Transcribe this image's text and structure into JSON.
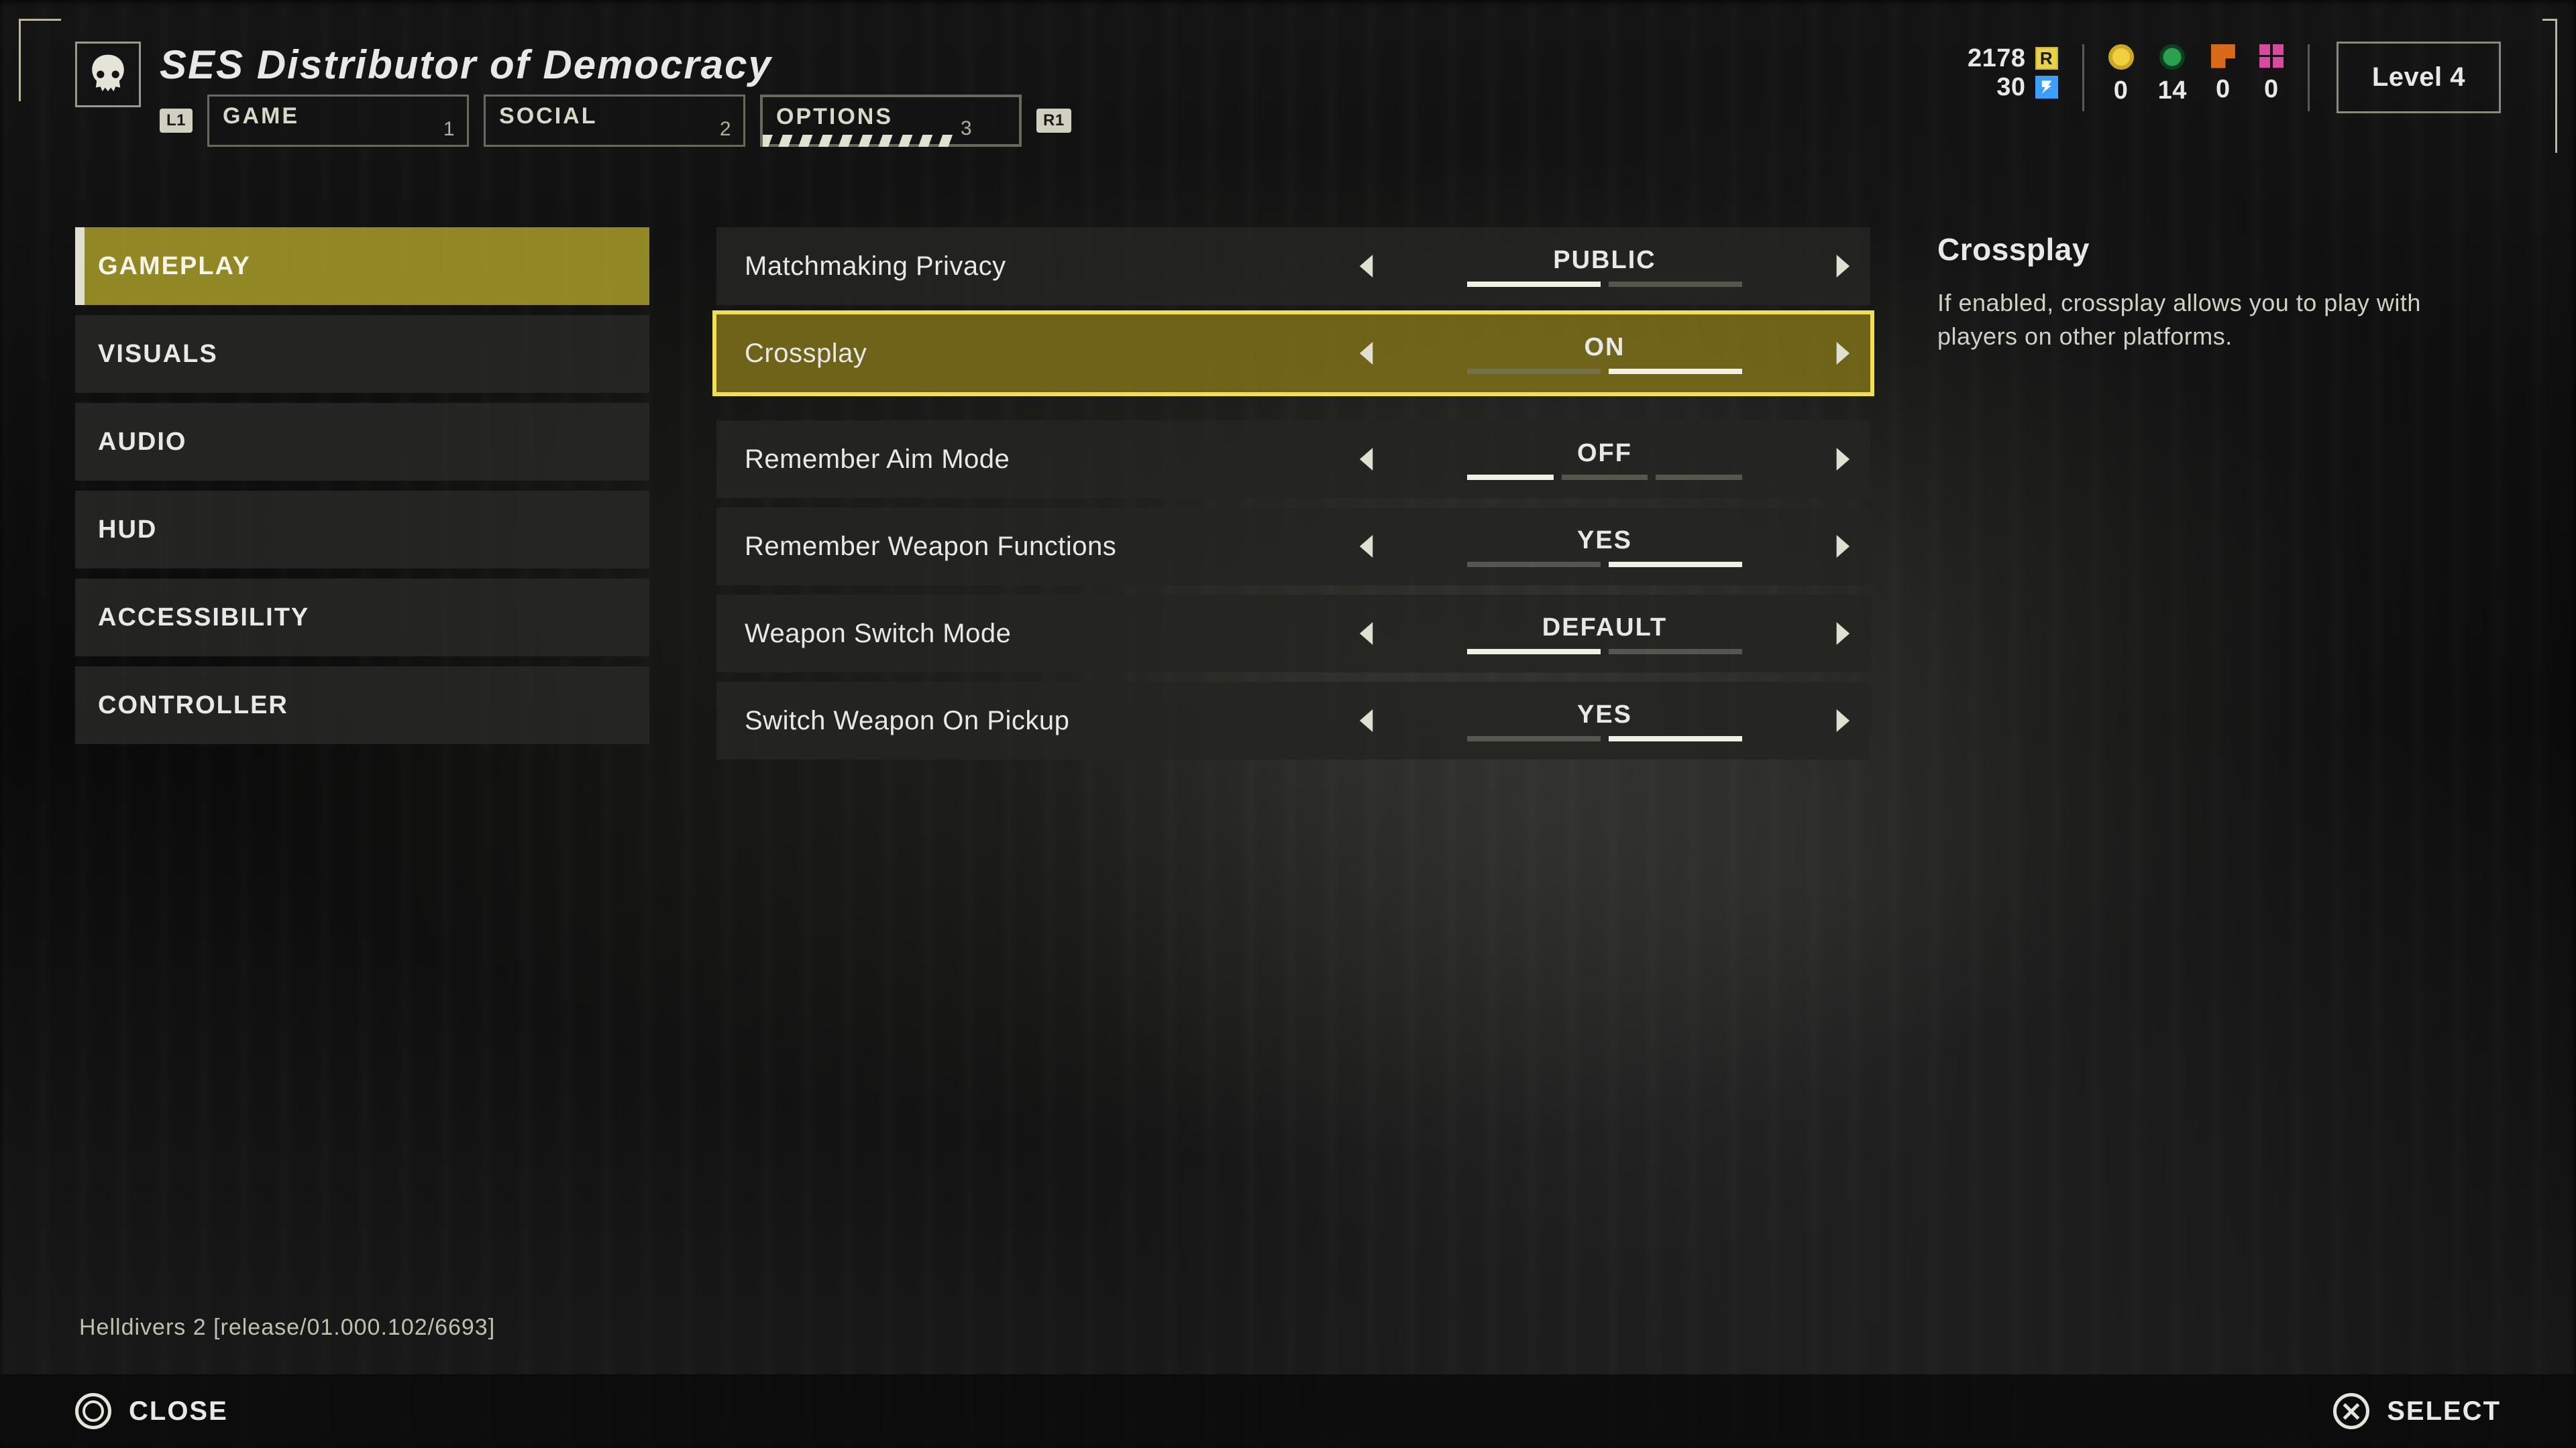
{
  "header": {
    "ship_title": "SES Distributor of Democracy",
    "bumper_left": "L1",
    "bumper_right": "R1",
    "tabs": [
      {
        "label": "GAME",
        "num": "1",
        "active": false
      },
      {
        "label": "SOCIAL",
        "num": "2",
        "active": false
      },
      {
        "label": "OPTIONS",
        "num": "3",
        "active": true
      }
    ]
  },
  "hud": {
    "req": "2178",
    "credits": "30",
    "stats": [
      {
        "icon": "warbond",
        "value": "0"
      },
      {
        "icon": "medal",
        "value": "14"
      },
      {
        "icon": "sample-orange",
        "value": "0"
      },
      {
        "icon": "sample-pink",
        "value": "0"
      }
    ],
    "level_label": "Level 4"
  },
  "sidebar": {
    "items": [
      {
        "label": "GAMEPLAY",
        "selected": true
      },
      {
        "label": "VISUALS",
        "selected": false
      },
      {
        "label": "AUDIO",
        "selected": false
      },
      {
        "label": "HUD",
        "selected": false
      },
      {
        "label": "ACCESSIBILITY",
        "selected": false
      },
      {
        "label": "CONTROLLER",
        "selected": false
      }
    ]
  },
  "settings": {
    "rows": [
      {
        "label": "Matchmaking Privacy",
        "value": "PUBLIC",
        "active_segment": 0,
        "total_segments": 2,
        "focused": false,
        "group": 0
      },
      {
        "label": "Crossplay",
        "value": "ON",
        "active_segment": 1,
        "total_segments": 2,
        "focused": true,
        "group": 0
      },
      {
        "label": "Remember Aim Mode",
        "value": "OFF",
        "active_segment": 0,
        "total_segments": 3,
        "focused": false,
        "group": 1
      },
      {
        "label": "Remember Weapon Functions",
        "value": "YES",
        "active_segment": 1,
        "total_segments": 2,
        "focused": false,
        "group": 1
      },
      {
        "label": "Weapon Switch Mode",
        "value": "DEFAULT",
        "active_segment": 0,
        "total_segments": 2,
        "focused": false,
        "group": 1
      },
      {
        "label": "Switch Weapon On Pickup",
        "value": "YES",
        "active_segment": 1,
        "total_segments": 2,
        "focused": false,
        "group": 1
      }
    ]
  },
  "info": {
    "title": "Crossplay",
    "description": "If enabled, crossplay allows you to play with players on other platforms."
  },
  "build": "Helldivers 2 [release/01.000.102/6693]",
  "footer": {
    "close": "CLOSE",
    "select": "SELECT"
  }
}
